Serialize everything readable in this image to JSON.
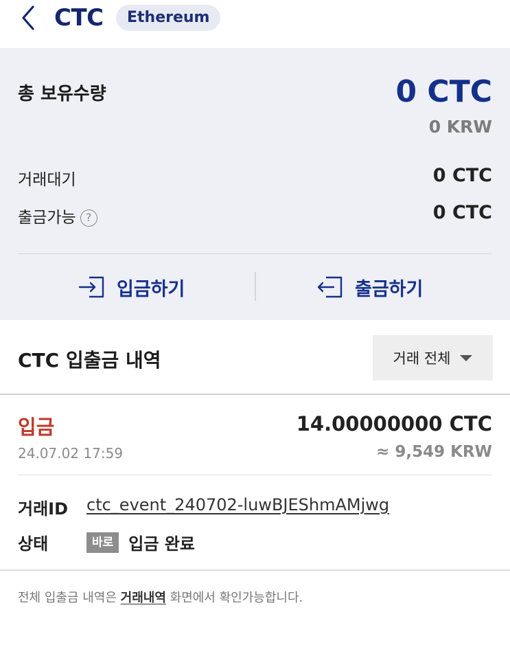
{
  "header": {
    "title": "CTC",
    "network_badge": "Ethereum",
    "back_icon": "chevron-left-icon"
  },
  "summary": {
    "total_label": "총 보유수량",
    "total_amount": "0 CTC",
    "total_krw": "0 KRW",
    "pending_label": "거래대기",
    "pending_value": "0 CTC",
    "withdrawable_label": "출금가능",
    "withdrawable_value": "0 CTC",
    "help_icon_glyph": "?"
  },
  "actions": {
    "deposit_label": "입금하기",
    "deposit_icon": "login-arrow-icon",
    "withdraw_label": "출금하기",
    "withdraw_icon": "logout-arrow-icon"
  },
  "history": {
    "title": "CTC 입출금 내역",
    "filter_label": "거래 전체",
    "transactions": [
      {
        "type": "입금",
        "amount": "14.00000000 CTC",
        "date": "24.07.02 17:59",
        "krw": "≈ 9,549 KRW",
        "txid_label": "거래ID",
        "txid": "ctc_event_240702-luwBJEShmAMjwg",
        "status_label": "상태",
        "status_badge": "바로",
        "status_text": "입금 완료"
      }
    ]
  },
  "footnote": {
    "prefix": "전체 입출금 내역은 ",
    "link": "거래내역",
    "suffix": " 화면에서 확인가능합니다."
  },
  "colors": {
    "brand_navy": "#14308a",
    "deposit_red": "#c0392b",
    "summary_bg": "#eef0f5",
    "muted_gray": "#8a8a8a"
  }
}
